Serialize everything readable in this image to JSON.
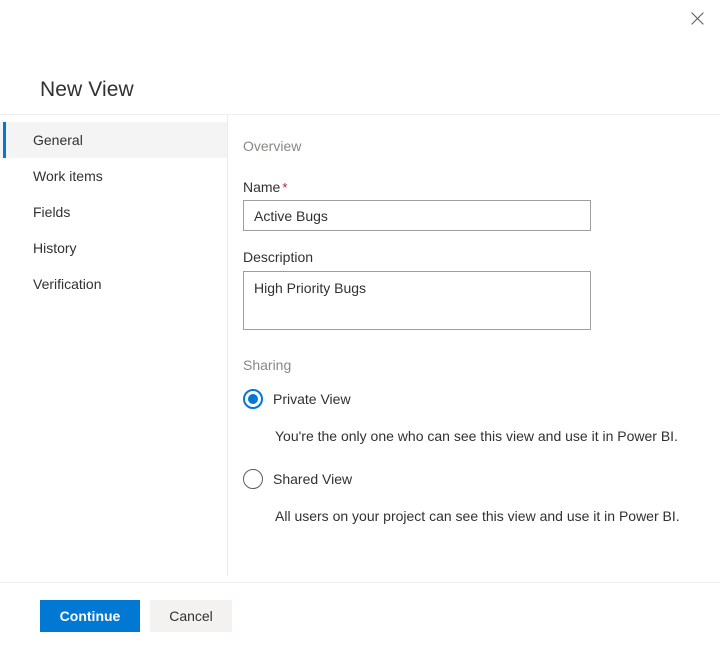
{
  "dialog": {
    "title": "New View",
    "close_icon": "close-icon",
    "close_label": "Close"
  },
  "nav": {
    "items": [
      {
        "label": "General",
        "selected": true
      },
      {
        "label": "Work items",
        "selected": false
      },
      {
        "label": "Fields",
        "selected": false
      },
      {
        "label": "History",
        "selected": false
      },
      {
        "label": "Verification",
        "selected": false
      }
    ]
  },
  "content": {
    "overview_heading": "Overview",
    "name": {
      "label": "Name",
      "required_marker": "*",
      "value": "Active Bugs",
      "placeholder": ""
    },
    "description": {
      "label": "Description",
      "value": "High Priority Bugs",
      "placeholder": ""
    },
    "sharing_heading": "Sharing",
    "sharing_options": [
      {
        "label": "Private View",
        "selected": true,
        "help": "You're the only one who can see this view and use it in Power BI."
      },
      {
        "label": "Shared View",
        "selected": false,
        "help": "All users on your project can see this view and use it in Power BI."
      }
    ]
  },
  "footer": {
    "continue_label": "Continue",
    "cancel_label": "Cancel"
  },
  "colors": {
    "accent": "#0078d4",
    "required": "#a4262c",
    "nav_selected_bg": "#f4f4f4",
    "secondary_button_bg": "#f3f2f1",
    "muted_text": "#8a8886",
    "body_text": "#323130",
    "border": "#a19f9d",
    "divider": "#edebe9"
  }
}
